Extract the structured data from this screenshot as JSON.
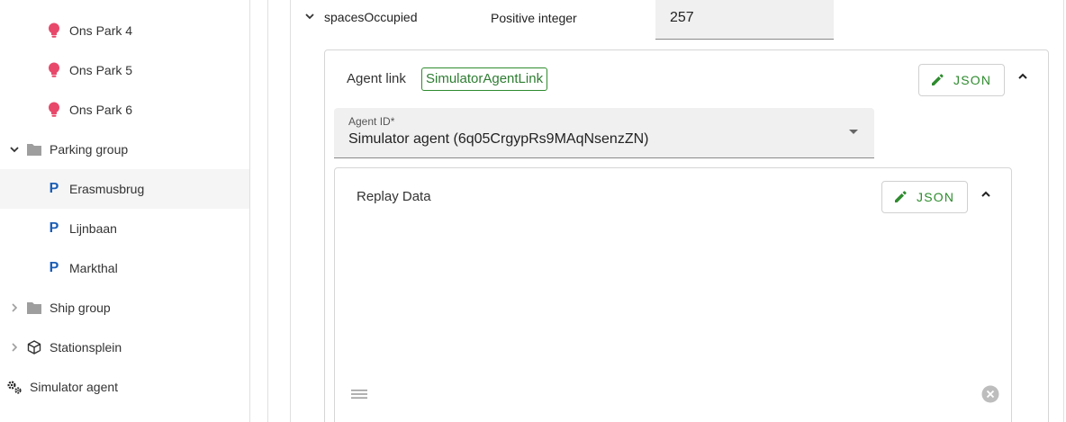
{
  "sidebar": {
    "items": [
      {
        "label": "Ons Park 4",
        "icon": "lightbulb-icon"
      },
      {
        "label": "Ons Park 5",
        "icon": "lightbulb-icon"
      },
      {
        "label": "Ons Park 6",
        "icon": "lightbulb-icon"
      },
      {
        "label": "Parking group",
        "icon": "folder-icon",
        "expanded": true
      },
      {
        "label": "Erasmusbrug",
        "icon": "parking-icon",
        "glyph": "P",
        "selected": true
      },
      {
        "label": "Lijnbaan",
        "icon": "parking-icon",
        "glyph": "P"
      },
      {
        "label": "Markthal",
        "icon": "parking-icon",
        "glyph": "P"
      },
      {
        "label": "Ship group",
        "icon": "folder-icon",
        "expanded": false
      },
      {
        "label": "Stationsplein",
        "icon": "cube-icon",
        "expanded": false
      },
      {
        "label": "Simulator agent",
        "icon": "gears-icon"
      }
    ]
  },
  "attribute": {
    "name": "spacesOccupied",
    "type": "Positive integer",
    "value": "257"
  },
  "agent_link": {
    "label": "Agent link",
    "type_chip": "SimulatorAgentLink",
    "json_button": "JSON",
    "agent_id_label": "Agent ID*",
    "agent_id_value": "Simulator agent (6q05CrgypRs9MAqNsenzZN)"
  },
  "replay": {
    "title": "Replay Data",
    "json_button": "JSON"
  },
  "colors": {
    "accent_green": "#2e8b2e",
    "lightbulb_pink": "#e8496b",
    "parking_blue": "#1b5eb5",
    "field_bg": "#f0f0f0"
  }
}
